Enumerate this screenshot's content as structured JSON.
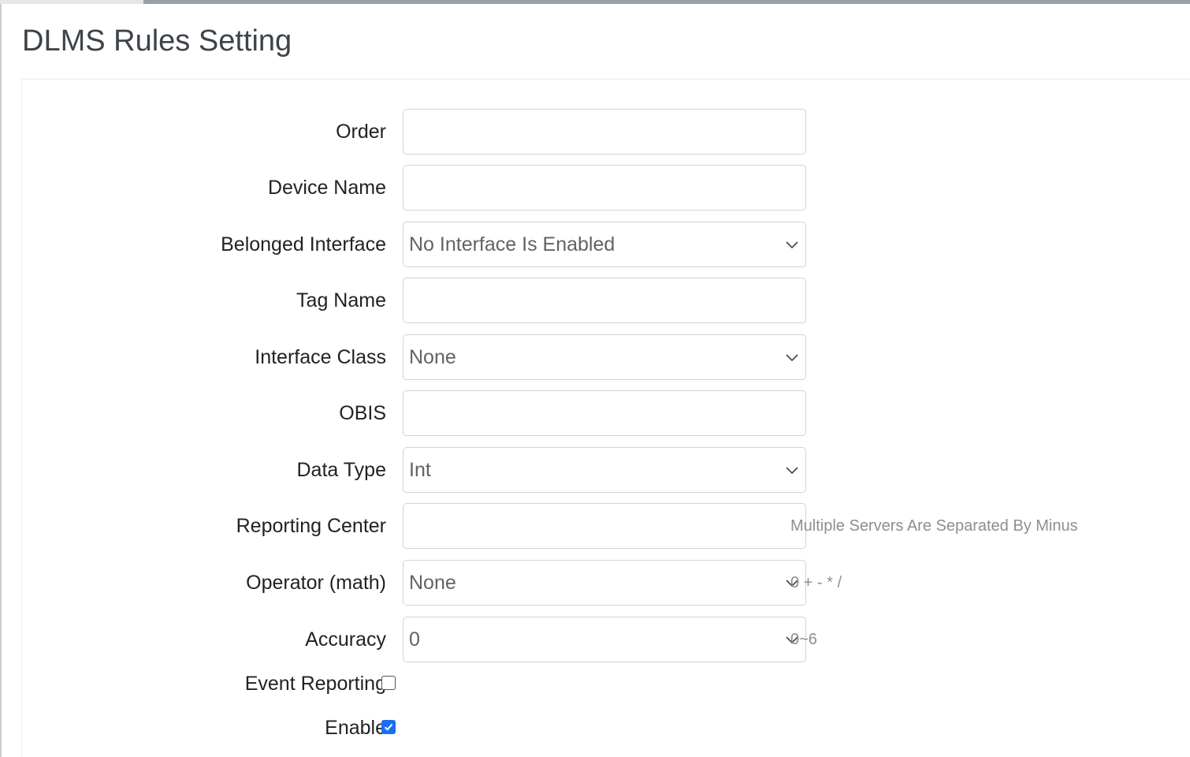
{
  "page": {
    "title": "DLMS Rules Setting"
  },
  "form": {
    "order": {
      "label": "Order",
      "value": ""
    },
    "device_name": {
      "label": "Device Name",
      "value": ""
    },
    "belonged_interface": {
      "label": "Belonged Interface",
      "selected": "No Interface Is Enabled"
    },
    "tag_name": {
      "label": "Tag Name",
      "value": ""
    },
    "interface_class": {
      "label": "Interface Class",
      "selected": "None"
    },
    "obis": {
      "label": "OBIS",
      "value": ""
    },
    "data_type": {
      "label": "Data Type",
      "selected": "Int"
    },
    "reporting_center": {
      "label": "Reporting Center",
      "value": "",
      "hint": "Multiple Servers Are Separated By Minus"
    },
    "operator": {
      "label": "Operator (math)",
      "selected": "None",
      "hint": "0 + - * /"
    },
    "accuracy": {
      "label": "Accuracy",
      "selected": "0",
      "hint": "0~6"
    },
    "event_reporting": {
      "label": "Event Reporting",
      "checked": false
    },
    "enable": {
      "label": "Enable",
      "checked": true
    }
  },
  "icons": {
    "select_arrow": "chevron-down-icon",
    "checkmark": "checkmark-icon"
  },
  "colors": {
    "accent": "#1a6ef5",
    "title": "#3d4349",
    "hint": "#8a8f95",
    "border": "#cfd4d9"
  }
}
